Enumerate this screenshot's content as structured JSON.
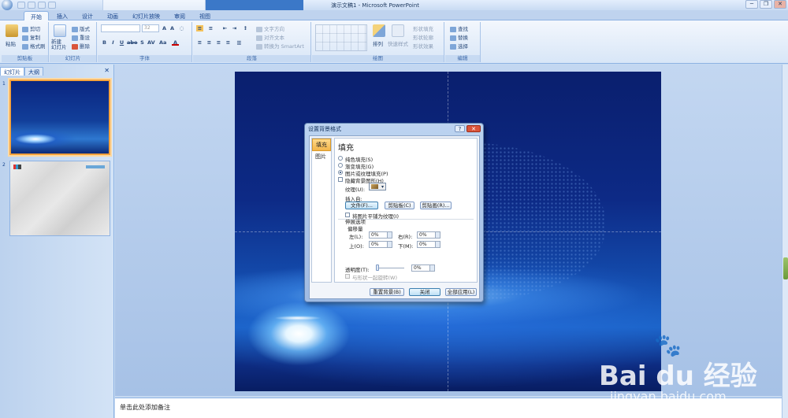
{
  "window": {
    "title": "演示文稿1 - Microsoft PowerPoint",
    "controls": [
      "─",
      "❐",
      "✕"
    ]
  },
  "ribbon_tabs": [
    "开始",
    "插入",
    "设计",
    "动画",
    "幻灯片放映",
    "审阅",
    "视图"
  ],
  "ribbon": {
    "clipboard": {
      "label": "剪贴板",
      "paste": "粘贴",
      "cut": "剪切",
      "copy": "复制",
      "format_painter": "格式刷"
    },
    "slides": {
      "label": "幻灯片",
      "new_slide": "新建\n幻灯片",
      "layout": "版式",
      "reset": "重设",
      "delete": "删除"
    },
    "font": {
      "label": "字体",
      "size": "32"
    },
    "paragraph": {
      "label": "段落",
      "text_direction": "文字方向",
      "align_text": "对齐文本",
      "convert_smartart": "转换为 SmartArt"
    },
    "drawing": {
      "label": "绘图",
      "arrange": "排列",
      "quick_styles": "快速样式",
      "shape_fill": "形状填充",
      "shape_outline": "形状轮廓",
      "shape_effects": "形状效果"
    },
    "editing": {
      "label": "编辑",
      "find": "查找",
      "replace": "替换",
      "select": "选择"
    }
  },
  "left_panel": {
    "tabs": [
      "幻灯片",
      "大纲"
    ],
    "close": "✕",
    "slides": [
      {
        "number": "1"
      },
      {
        "number": "2"
      }
    ]
  },
  "notes_placeholder": "单击此处添加备注",
  "dialog": {
    "title": "设置背景格式",
    "help": "?",
    "close": "✕",
    "nav": [
      "填充",
      "图片"
    ],
    "heading": "填充",
    "fill_options": [
      "纯色填充(S)",
      "渐变填充(G)",
      "图片或纹理填充(P)",
      "隐藏背景图形(H)"
    ],
    "texture_label": "纹理(U):",
    "insert_from_label": "插入自:",
    "btn_file": "文件(F)...",
    "btn_clipboard": "剪贴板(C)",
    "btn_clipart": "剪贴画(R)...",
    "tile_label": "将图片平铺为纹理(I)",
    "tiling_options": "伸展选项",
    "offsets": "偏移量",
    "left_label": "左(L):",
    "left_val": "0%",
    "right_label": "右(R):",
    "right_val": "0%",
    "top_label": "上(O):",
    "top_val": "0%",
    "bottom_label": "下(M):",
    "bottom_val": "0%",
    "transparency_label": "透明度(T):",
    "transparency_val": "0%",
    "rotate_label": "与形状一起旋转(W)",
    "btn_reset": "重置背景(B)",
    "btn_close": "关闭",
    "btn_apply_all": "全部应用(L)"
  },
  "watermark": {
    "paw": "🐾",
    "brand": "Bai  du 经验",
    "url": "jingyan.baidu.com"
  }
}
